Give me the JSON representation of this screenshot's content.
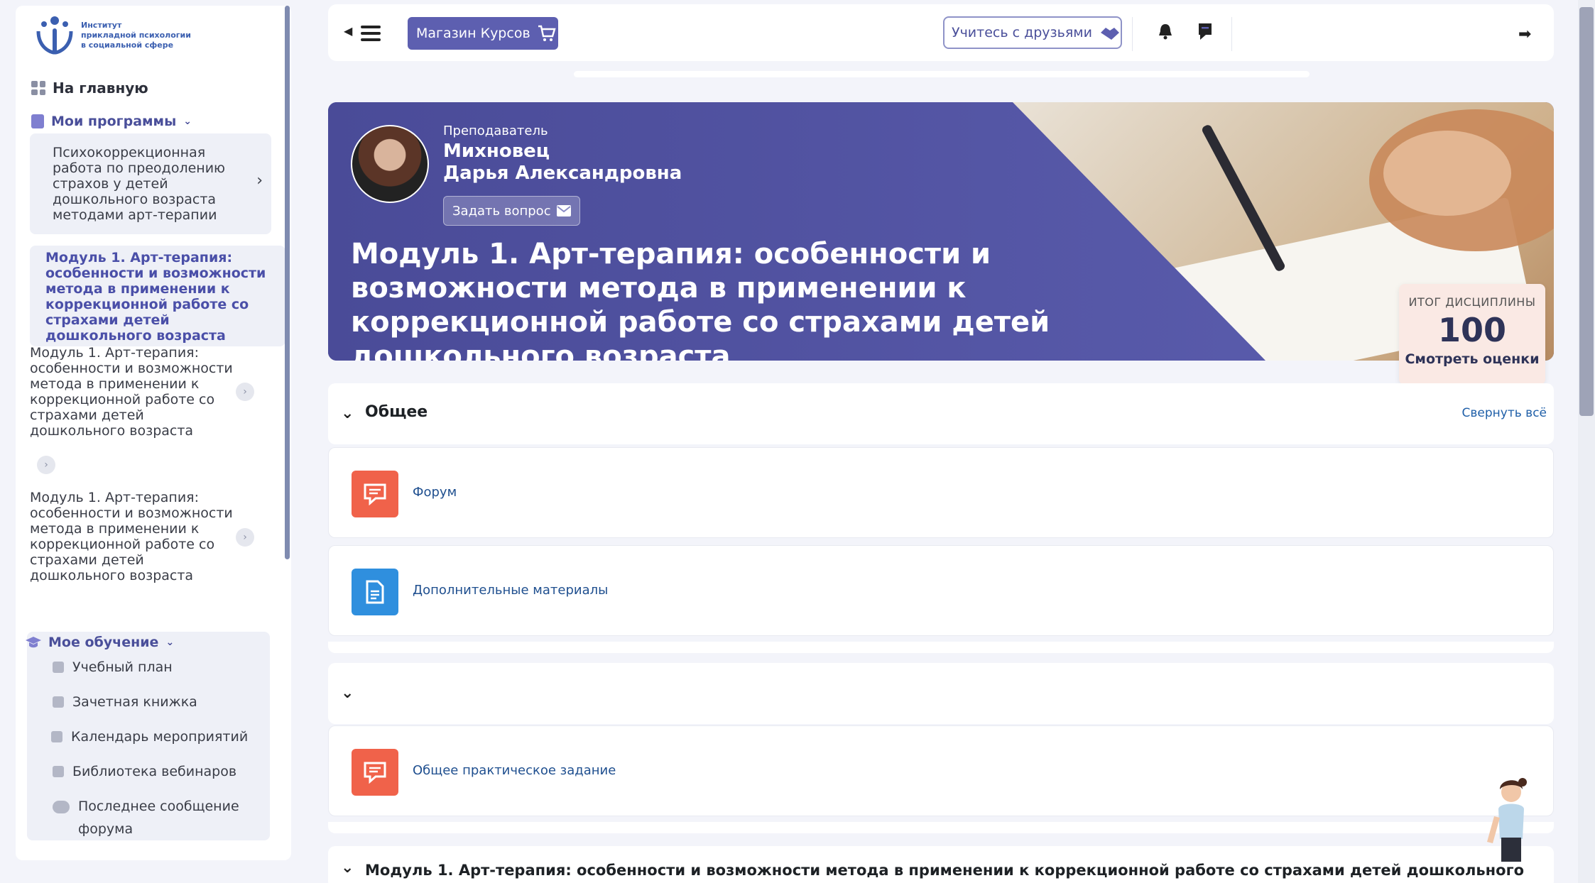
{
  "logo": {
    "line1": "Институт",
    "line2": "прикладной психологии",
    "line3": "в социальной сфере"
  },
  "sidebar": {
    "home": "На главную",
    "programs_title": "Мои программы",
    "program_card": "Психокоррекционная работа по преодолению страхов у детей дошкольного возраста методами арт-терапии",
    "module_active": "Модуль 1. Арт-терапия: особенности и возможности метода в применении к коррекционной работе со страхами детей дошкольного возраста",
    "module_items": [
      "Модуль 1. Арт-терапия: особенности и возможности метода в применении к коррекционной работе со страхами детей дошкольного возраста",
      "Модуль 1. Арт-терапия: особенности и возможности метода в применении к коррекционной работе со страхами детей дошкольного возраста"
    ],
    "learning_title": "Мое обучение",
    "learning_items": [
      "Учебный план",
      "Зачетная книжка",
      "Календарь мероприятий",
      "Библиотека вебинаров",
      "Последнее сообщение форума"
    ]
  },
  "topbar": {
    "shop_label": "Магазин Курсов",
    "friends_label": "Учитесь с друзьями"
  },
  "hero": {
    "teacher_role": "Преподаватель",
    "teacher_surname": "Михновец",
    "teacher_name": "Дарья Александровна",
    "ask_label": "Задать вопрос",
    "title": "Модуль 1. Арт-терапия: особенности и возможности метода в применении к коррекционной работе со страхами детей дошкольного возраста"
  },
  "grade": {
    "label": "ИТОГ ДИСЦИПЛИНЫ",
    "value": "100",
    "link": "Смотреть оценки"
  },
  "sections": {
    "general_title": "Общее",
    "collapse_all": "Свернуть всё",
    "forum": "Форум",
    "materials": "Дополнительные материалы",
    "practical": "Общее практическое задание",
    "module_title": "Модуль 1. Арт-терапия: особенности и возможности метода в применении к коррекционной работе со страхами детей дошкольного возраста"
  },
  "colors": {
    "primary": "#5d5fb0",
    "hero": "#4a4b98",
    "forum_icon": "#f0624a",
    "doc_icon": "#2f8fde",
    "link": "#1f4f8f"
  }
}
